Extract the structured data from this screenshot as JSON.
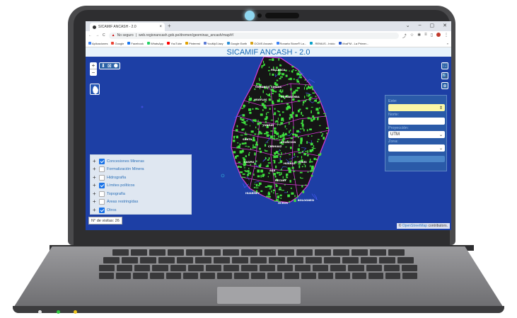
{
  "browser": {
    "tab_title": "SICAMIF ANCASH - 2.0",
    "tab_close": "×",
    "new_tab": "+",
    "window_controls": [
      "⌄",
      "–",
      "▢",
      "✕"
    ],
    "nav": [
      "←",
      "→",
      "C"
    ],
    "security_label": "No seguro",
    "url": "web.regionancash.gob.pe/dremen/geominas_ancash/map/#/",
    "bookmarks": [
      "Aplicaciones",
      "Google",
      "Facebook",
      "WhatsApp",
      "YouTube",
      "Pinterest",
      "YouMp3.lazy",
      "Google Earth",
      "OCMS Ancash",
      "Ronarta Stone® La...",
      "- RENIUS - Inicio",
      "VivaFM - La Primer..."
    ]
  },
  "page": {
    "title": "SICAMIF ANCASH - 2.0"
  },
  "map": {
    "zoom_in": "+",
    "zoom_out": "−",
    "tools": [
      "⬇",
      "⊠",
      "⬢"
    ],
    "right_controls": [
      "⛶",
      "🔍",
      "⊕"
    ],
    "visits_label": "N° de visitas: 26",
    "attribution_prefix": "© ",
    "attribution_link": "OpenStreetMap",
    "attribution_suffix": " contributors.",
    "place_labels": [
      "HUARI",
      "ASUNCION",
      "CARHUAZ",
      "YUNGAY",
      "HUARAZ",
      "AIJA",
      "RECUAY",
      "OCROS",
      "BOLOGNESI",
      "HUARMEY",
      "HUAYLAS",
      "POMABAMBA",
      "SIHUAS",
      "PALLASCA",
      "CORONGO",
      "SANTA",
      "CASMA"
    ]
  },
  "layers": [
    {
      "label": "Concesiones Mineras",
      "checked": true
    },
    {
      "label": "Formalización Minera",
      "checked": false
    },
    {
      "label": "Hidrografía",
      "checked": false
    },
    {
      "label": "Límites políticos",
      "checked": true
    },
    {
      "label": "Topografía",
      "checked": false
    },
    {
      "label": "Áreas restringidas",
      "checked": false
    },
    {
      "label": "Otros",
      "checked": true
    }
  ],
  "coords_panel": {
    "este_label": "Este:",
    "norte_label": "Norte:",
    "proyeccion_label": "Proyección:",
    "proyeccion_value": "UTM",
    "zona_label": "Zona:"
  },
  "colors": {
    "map_bg": "#1d3fa5",
    "region_fill": "#151515",
    "concession": "#3fe03f",
    "boundary": "#d63bd6"
  }
}
